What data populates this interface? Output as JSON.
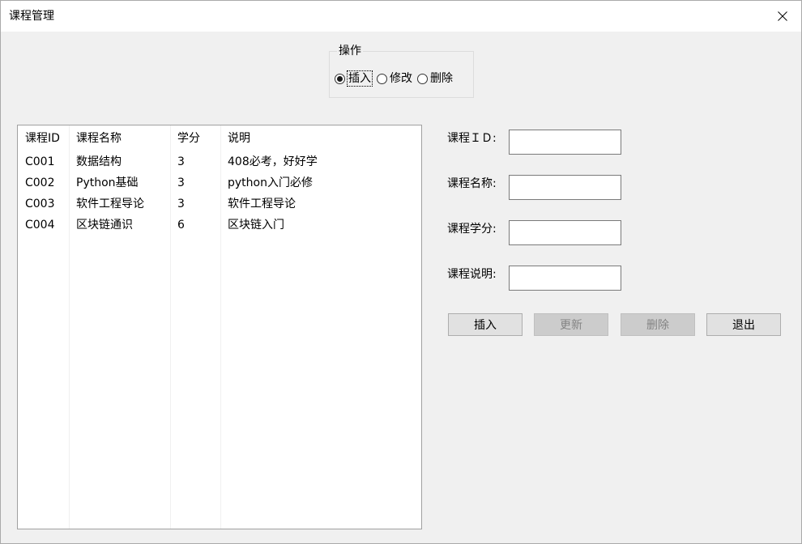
{
  "window": {
    "title": "课程管理"
  },
  "operation": {
    "legend": "操作",
    "options": [
      {
        "label": "插入",
        "checked": true
      },
      {
        "label": "修改",
        "checked": false
      },
      {
        "label": "删除",
        "checked": false
      }
    ]
  },
  "table": {
    "columns": [
      "课程ID",
      "课程名称",
      "学分",
      "说明"
    ],
    "rows": [
      [
        "C001",
        "数据结构",
        "3",
        "408必考，好好学"
      ],
      [
        "C002",
        "Python基础",
        "3",
        "python入门必修"
      ],
      [
        "C003",
        "软件工程导论",
        "3",
        "软件工程导论"
      ],
      [
        "C004",
        "区块链通识",
        "6",
        "区块链入门"
      ]
    ]
  },
  "form": {
    "fields": [
      {
        "label": "课程ＩＤ:",
        "value": ""
      },
      {
        "label": "课程名称:",
        "value": ""
      },
      {
        "label": "课程学分:",
        "value": ""
      },
      {
        "label": "课程说明:",
        "value": ""
      }
    ]
  },
  "buttons": {
    "insert": "插入",
    "update": "更新",
    "delete": "删除",
    "exit": "退出"
  }
}
